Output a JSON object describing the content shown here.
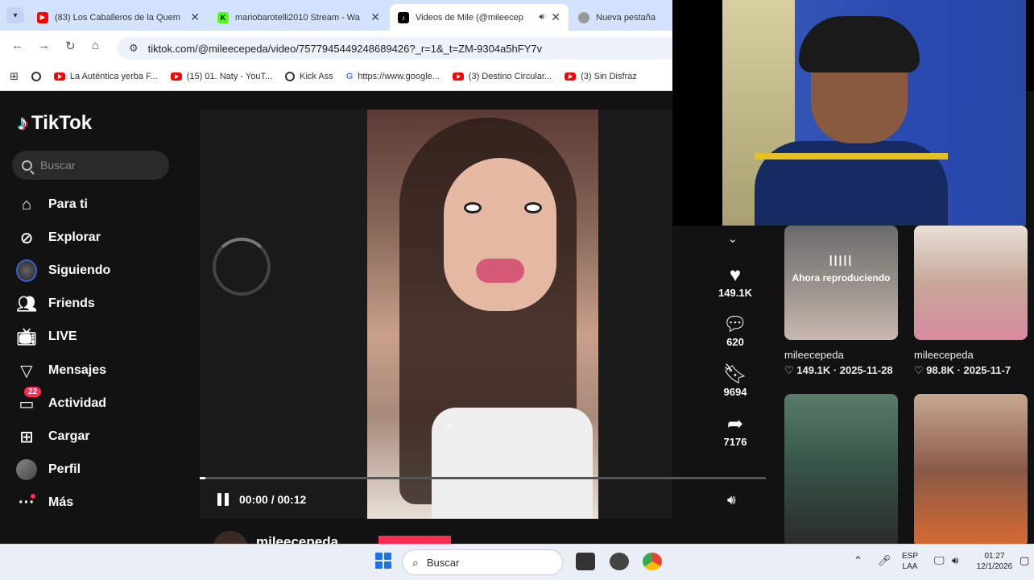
{
  "browser": {
    "tabs": [
      {
        "title": "(83) Los Caballeros de la Quem",
        "icon": "youtube-icon"
      },
      {
        "title": "mariobarotelli2010 Stream - Wa",
        "icon": "kick-icon"
      },
      {
        "title": "Videos de Mile (@mileecep",
        "icon": "tiktok-icon",
        "active": true
      },
      {
        "title": "Nueva pestaña",
        "icon": "chrome-icon"
      }
    ],
    "url": "tiktok.com/@mileecepeda/video/7577945449248689426?_r=1&_t=ZM-9304a5hFY7v",
    "bookmarks": [
      {
        "label": "",
        "icon": "globe-icon"
      },
      {
        "label": "La Auténtica yerba F...",
        "icon": "youtube-icon"
      },
      {
        "label": "(15) 01. Naty - YouT...",
        "icon": "youtube-icon"
      },
      {
        "label": "Kick Ass",
        "icon": "globe-icon"
      },
      {
        "label": "https://www.google...",
        "icon": "google-icon"
      },
      {
        "label": "(3) Destino Circular...",
        "icon": "youtube-icon"
      },
      {
        "label": "(3) Sin Disfraz",
        "icon": "youtube-icon"
      }
    ]
  },
  "tiktok": {
    "logo": "TikTok",
    "search_placeholder": "Buscar",
    "nav": [
      {
        "label": "Para ti",
        "icon": "home-icon"
      },
      {
        "label": "Explorar",
        "icon": "compass-icon"
      },
      {
        "label": "Siguiendo",
        "icon": "following-avatar-icon"
      },
      {
        "label": "Friends",
        "icon": "friends-icon"
      },
      {
        "label": "LIVE",
        "icon": "live-icon"
      },
      {
        "label": "Mensajes",
        "icon": "messages-icon"
      },
      {
        "label": "Actividad",
        "icon": "activity-icon",
        "badge": "22"
      },
      {
        "label": "Cargar",
        "icon": "upload-icon"
      },
      {
        "label": "Perfil",
        "icon": "profile-avatar-icon"
      },
      {
        "label": "Más",
        "icon": "more-icon"
      }
    ],
    "player": {
      "time": "00:00 / 00:12",
      "progress": 0.01,
      "likes": "149.1K",
      "comments": "620",
      "saves": "9694",
      "shares": "7176",
      "author": "mileecepeda"
    },
    "related": [
      {
        "user": "mileecepeda",
        "likes": "149.1K",
        "date": "2025-11-28",
        "overlay": "Ahora reproduciendo"
      },
      {
        "user": "mileecepeda",
        "likes": "98.8K",
        "date": "2025-11-7",
        "overlay": ""
      }
    ]
  },
  "taskbar": {
    "search_label": "Buscar",
    "lang_top": "ESP",
    "lang_bottom": "LAA",
    "time": "01:27",
    "date": "12/1/2026"
  },
  "colors": {
    "tiktok_accent": "#fe2c55",
    "chrome_tab_bg": "#d3e3fd",
    "page_bg": "#121212"
  }
}
